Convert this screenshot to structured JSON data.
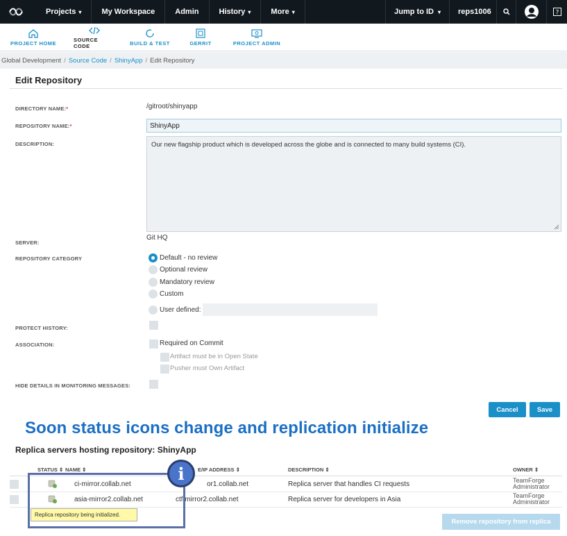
{
  "topbar": {
    "nav": [
      {
        "label": "Projects",
        "caret": true
      },
      {
        "label": "My Workspace",
        "caret": false
      },
      {
        "label": "Admin",
        "caret": false
      },
      {
        "label": "History",
        "caret": true
      },
      {
        "label": "More",
        "caret": true
      }
    ],
    "jump_label": "Jump to ID",
    "jump_value": "reps1006"
  },
  "project_nav": [
    {
      "label": "PROJECT HOME",
      "icon": "home-icon"
    },
    {
      "label": "SOURCE CODE",
      "icon": "code-icon"
    },
    {
      "label": "BUILD & TEST",
      "icon": "refresh-icon"
    },
    {
      "label": "GERRIT",
      "icon": "gerrit-icon"
    },
    {
      "label": "PROJECT ADMIN",
      "icon": "admin-icon"
    }
  ],
  "breadcrumb": {
    "project": "Global Development",
    "section": "Source Code",
    "repo": "ShinyApp",
    "current": "Edit Repository"
  },
  "page_title": "Edit Repository",
  "form": {
    "directory_label": "DIRECTORY NAME:",
    "directory_value": "/gitroot/shinyapp",
    "repo_name_label": "REPOSITORY NAME:",
    "repo_name_value": "ShinyApp",
    "description_label": "DESCRIPTION:",
    "description_value": "Our new flagship product which is developed across the globe and is connected to many build systems (CI).",
    "server_label": "SERVER:",
    "server_value": "Git HQ",
    "category_label": "REPOSITORY CATEGORY",
    "categories": [
      "Default - no review",
      "Optional review",
      "Mandatory review",
      "Custom",
      "User defined:"
    ],
    "protect_label": "PROTECT HISTORY:",
    "association_label": "ASSOCIATION:",
    "required_commit": "Required on Commit",
    "artifact_open": "Artifact must be in Open State",
    "pusher_own": "Pusher must Own Artifact",
    "hide_details_label": "HIDE DETAILS IN MONITORING MESSAGES:",
    "cancel_label": "Cancel",
    "save_label": "Save"
  },
  "overlay_caption": "Soon status icons change and replication initialize",
  "replica": {
    "title": "Replica servers hosting repository: ShinyApp",
    "headers": {
      "status": "STATUS ⇕",
      "name": "NAME ⇕",
      "address": "E/IP ADDRESS ⇕",
      "description": "DESCRIPTION ⇕",
      "owner": "OWNER ⇕"
    },
    "rows": [
      {
        "name": "ci-mirror.collab.net",
        "address": "or1.collab.net",
        "description": "Replica server that handles CI requests",
        "owner1": "TeamForge",
        "owner2": "Administrator"
      },
      {
        "name": "asia-mirror2.collab.net",
        "address": "ctf mirror2.collab.net",
        "description": "Replica server for developers in Asia",
        "owner1": "TeamForge",
        "owner2": "Administrator"
      }
    ],
    "tooltip": "Replica repository being initialized.",
    "remove_label": "Remove repository from replica"
  },
  "colors": {
    "accent": "#1b8fc8",
    "topbar": "#11181e",
    "caption": "#1b6fc4"
  }
}
